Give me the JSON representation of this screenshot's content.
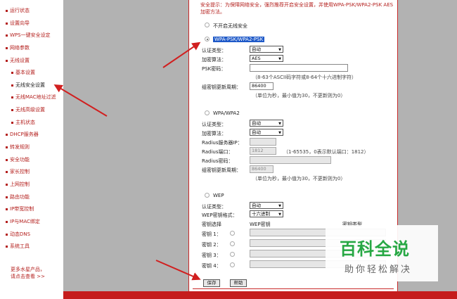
{
  "sidebar": {
    "items": [
      "运行状态",
      "设置向导",
      "WPS一键安全设定",
      "网络参数",
      "无线设置",
      "基本设置",
      "无线安全设置",
      "无线MAC地址过滤",
      "无线高级设置",
      "主机状态",
      "DHCP服务器",
      "转发规则",
      "安全功能",
      "家长控制",
      "上网控制",
      "路由功能",
      "IP带宽控制",
      "IP与MAC绑定",
      "动态DNS",
      "系统工具"
    ],
    "more_line1": "更多水星产品，",
    "more_line2": "请点击查看 >>"
  },
  "tip": {
    "line1": "安全提示：为保障网络安全，强烈推荐开启安全设置，并使用WPA-PSK/WPA2-PSK AES",
    "line2": "加密方法。"
  },
  "options": {
    "off": "不开启无线安全",
    "wpa_psk": "WPA-PSK/WPA2-PSK",
    "wpa": "WPA/WPA2",
    "wep": "WEP"
  },
  "psk": {
    "auth_label": "认证类型：",
    "auth_value": "自动",
    "enc_label": "加密算法：",
    "enc_value": "AES",
    "pwd_label": "PSK密码：",
    "pwd_note": "（8-63个ASCII码字符或8-64个十六进制字符）",
    "period_label": "组密钥更新周期：",
    "period_value": "86400",
    "period_note": "（单位为秒，最小值为30，不更新则为0）"
  },
  "wpa": {
    "auth_label": "认证类型：",
    "auth_value": "自动",
    "enc_label": "加密算法：",
    "enc_value": "自动",
    "radius_ip_label": "Radius服务器IP：",
    "radius_port_label": "Radius端口：",
    "radius_port_value": "1812",
    "radius_port_note": "（1-65535，0表示默认端口：1812）",
    "radius_pwd_label": "Radius密码：",
    "period_label": "组密钥更新周期：",
    "period_value": "86400",
    "period_note": "（单位为秒，最小值为30，不更新则为0）"
  },
  "wep": {
    "auth_label": "认证类型：",
    "auth_value": "自动",
    "format_label": "WEP密钥格式：",
    "format_value": "十六进制",
    "col_select": "密钥选择",
    "col_key": "WEP密钥",
    "col_type": "密钥类型",
    "keys": [
      "密钥 1：",
      "密钥 2：",
      "密钥 3：",
      "密钥 4："
    ]
  },
  "buttons": {
    "save": "保存",
    "help": "帮助"
  },
  "watermark": {
    "title": "百科全说",
    "subtitle": "助你轻松解决"
  },
  "colors": {
    "brand_red": "#c51c1c",
    "accent_green": "#27a844",
    "frame_gray": "#b2b2b2"
  }
}
